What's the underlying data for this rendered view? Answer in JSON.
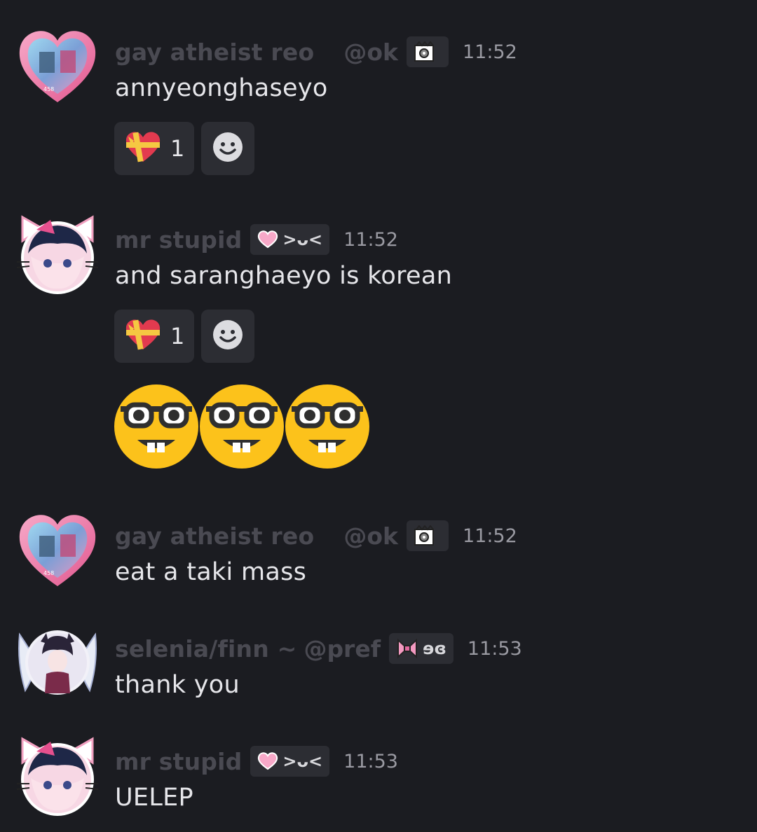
{
  "messages": [
    {
      "author": "gay atheist reo",
      "handle": "@ok",
      "tag_text": "",
      "tag_icon": "crown-camera-icon",
      "time": "11:52",
      "text": "annyeonghaseyo",
      "reactions": [
        {
          "emoji": "heart-ribbon-icon",
          "count": "1"
        }
      ]
    },
    {
      "author": "mr stupid",
      "handle": "",
      "tag_text": ">ᴗ<",
      "tag_icon": "pink-heart-icon",
      "time": "11:52",
      "text": "and saranghaeyo is korean",
      "reactions": [
        {
          "emoji": "heart-ribbon-icon",
          "count": "1"
        }
      ],
      "big_emojis": [
        "nerd-face-icon",
        "nerd-face-icon",
        "nerd-face-icon"
      ]
    },
    {
      "author": "gay atheist reo",
      "handle": "@ok",
      "tag_text": "",
      "tag_icon": "crown-camera-icon",
      "time": "11:52",
      "text": "eat a taki mass"
    },
    {
      "author": "selenia/finn ~",
      "handle": "@pref",
      "tag_text": "ɘɞ",
      "tag_icon": "pink-bow-icon",
      "time": "11:53",
      "text": "thank you"
    },
    {
      "author": "mr stupid",
      "handle": "",
      "tag_text": ">ᴗ<",
      "tag_icon": "pink-heart-icon",
      "time": "11:53",
      "text": "UELEP"
    }
  ],
  "colors": {
    "background": "#1b1c21",
    "chip": "#2c2d33",
    "name": "#4a4a52",
    "text": "#e6e6ea",
    "time": "#9a9aa2"
  }
}
